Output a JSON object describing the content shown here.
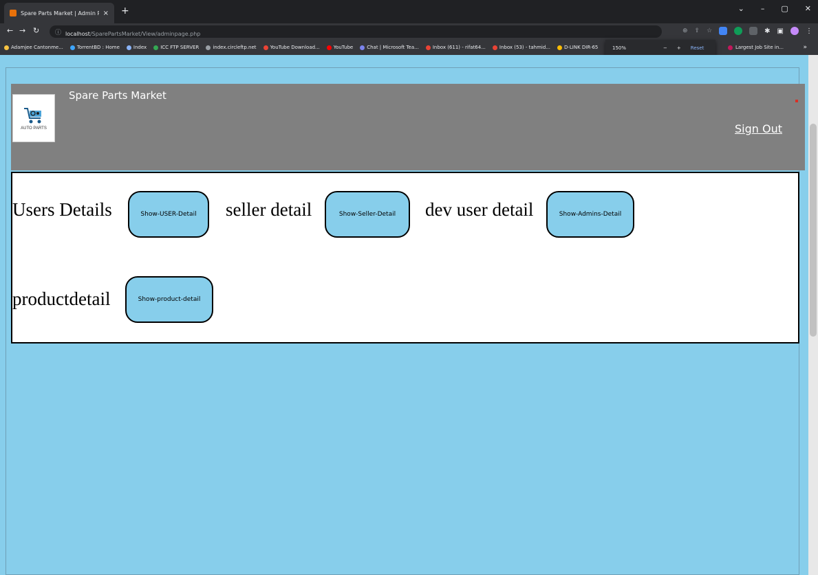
{
  "browser": {
    "tab_title": "Spare Parts Market | Admin Panel",
    "tab_close": "×",
    "new_tab": "+",
    "url_host": "localhost",
    "url_path": "/SparePartsMarket/View/adminpage.php",
    "window_controls": [
      "⌄",
      "–",
      "▢",
      "✕"
    ],
    "bookmarks": [
      {
        "label": "Adamjee Cantonme...",
        "color": "#f6c342"
      },
      {
        "label": "TorrentBD : Home",
        "color": "#3ea6ff"
      },
      {
        "label": "Index",
        "color": "#8ab4f8"
      },
      {
        "label": "ICC FTP SERVER",
        "color": "#34a853"
      },
      {
        "label": "index.circleftp.net",
        "color": "#9aa0a6"
      },
      {
        "label": "YouTube Download...",
        "color": "#ea4335"
      },
      {
        "label": "YouTube",
        "color": "#ff0000"
      },
      {
        "label": "Chat | Microsoft Tea...",
        "color": "#7b83eb"
      },
      {
        "label": "Inbox (611) - rifat64...",
        "color": "#ea4335"
      },
      {
        "label": "Inbox (53) - tahmid...",
        "color": "#ea4335"
      },
      {
        "label": "D-LINK DIR-65",
        "color": "#fbbc04"
      }
    ],
    "zoom": {
      "value": "150%",
      "minus": "−",
      "plus": "+",
      "reset": "Reset"
    },
    "bookmark_right": {
      "label": "Largest Job Site in...",
      "color": "#c2185b"
    },
    "bookmark_more": "»"
  },
  "header": {
    "site_title": "Spare Parts Market",
    "logo_text": "AUTO PARTS",
    "sign_out": "Sign Out",
    "background": "#808080"
  },
  "panel": {
    "rows": [
      {
        "label": "Users Details",
        "button": "Show-USER-Detail"
      },
      {
        "label": "seller detail",
        "button": "Show-Seller-Detail"
      },
      {
        "label": "dev user detail",
        "button": "Show-Admins-Detail"
      },
      {
        "label": "productdetail",
        "button": "Show-product-detail"
      }
    ]
  },
  "colors": {
    "page_background": "#87ceeb",
    "button_fill": "#87ceeb"
  }
}
